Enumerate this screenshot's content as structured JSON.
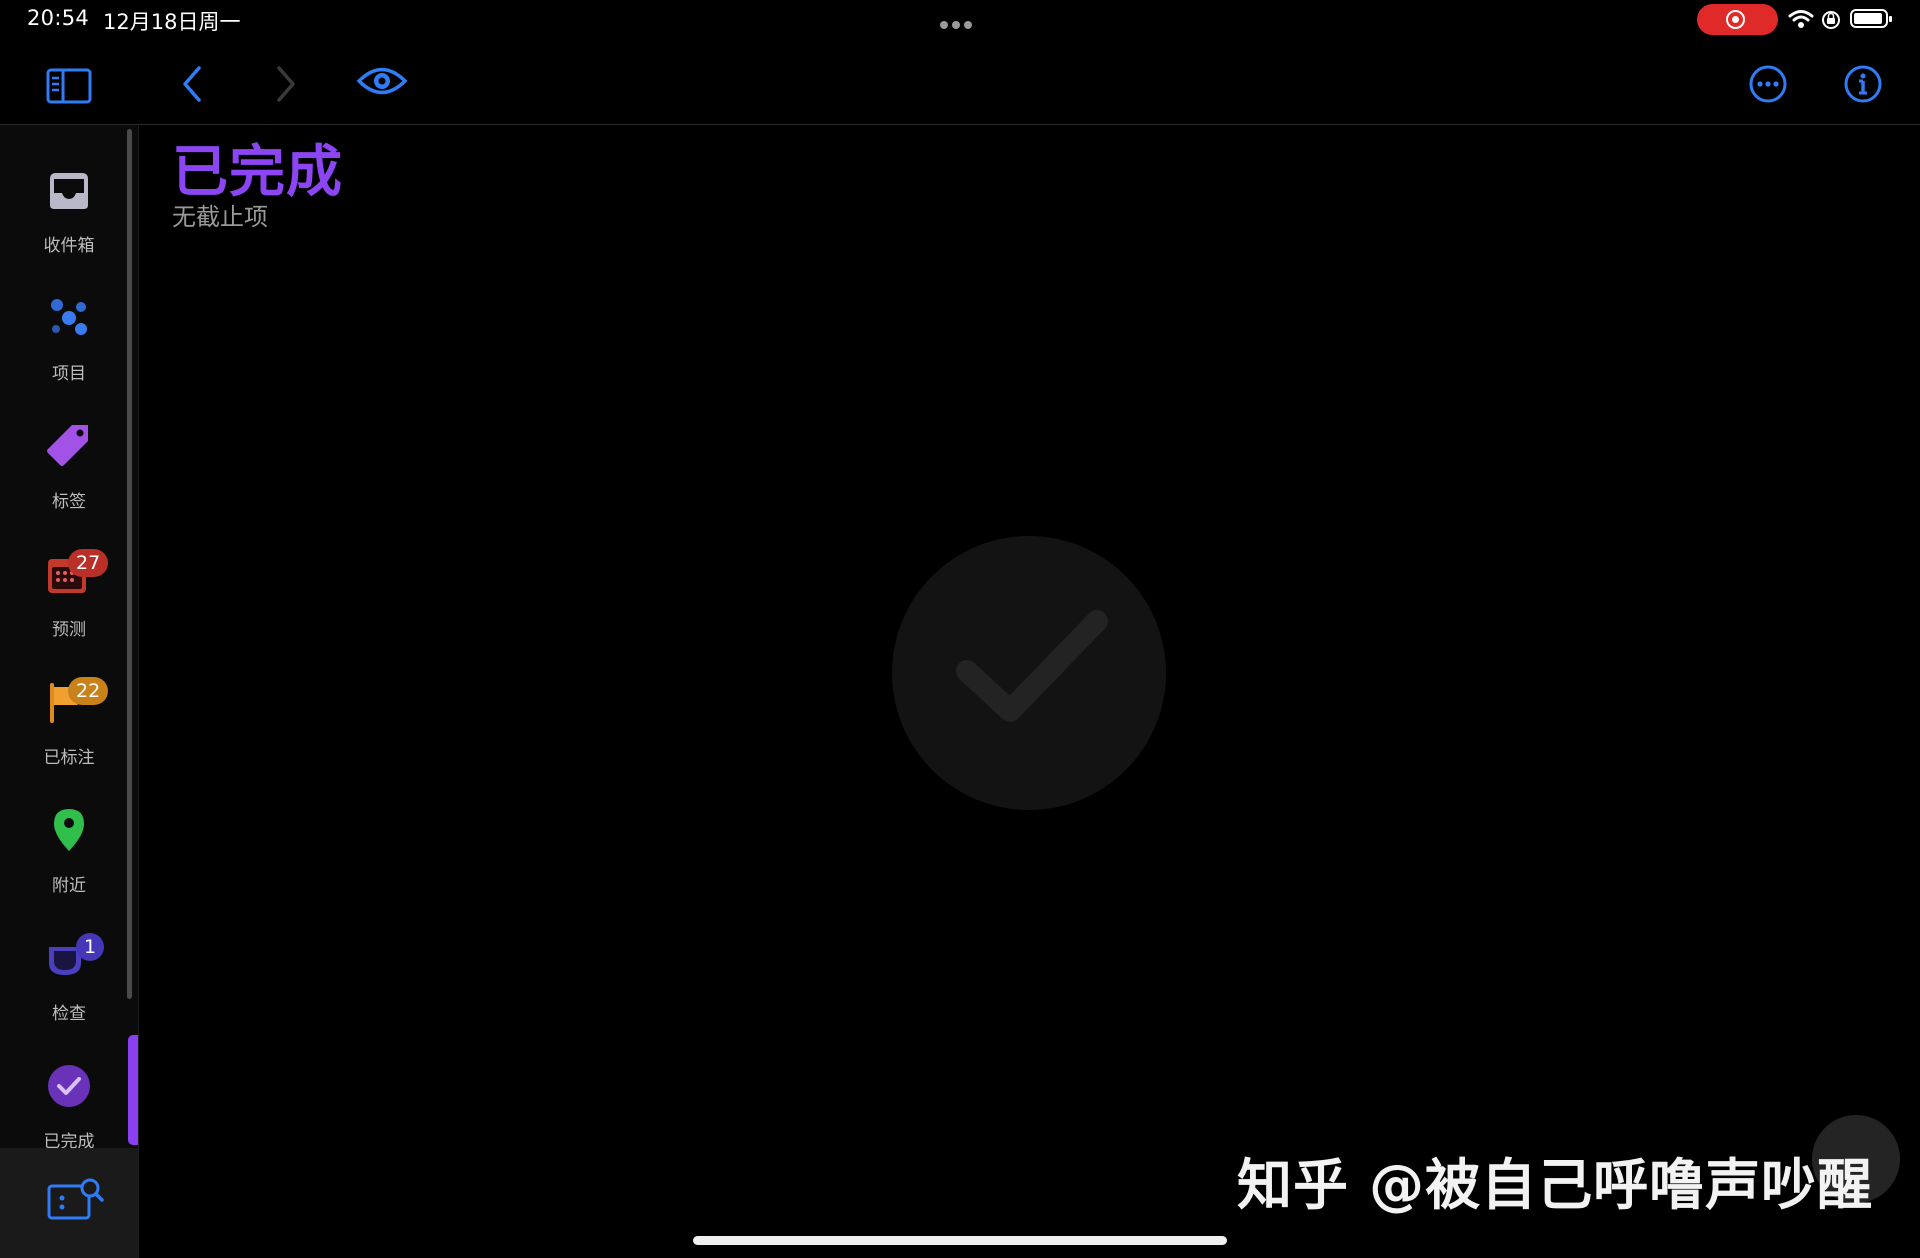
{
  "status_bar": {
    "time": "20:54",
    "date": "12月18日周一"
  },
  "toolbar": {
    "sidebar_toggle_icon": "sidebar-icon",
    "back_icon": "chevron-left-icon",
    "forward_icon": "chevron-right-icon",
    "perspective_icon": "eye-icon",
    "more_icon": "ellipsis-circle-icon",
    "info_icon": "info-circle-icon",
    "accent_color": "#2f7cf6"
  },
  "sidebar": {
    "items": [
      {
        "label": "收件箱",
        "icon": "inbox-icon"
      },
      {
        "label": "项目",
        "icon": "projects-icon"
      },
      {
        "label": "标签",
        "icon": "tag-icon"
      },
      {
        "label": "预测",
        "icon": "calendar-icon",
        "badge": "27",
        "badge_color": "#c0392b"
      },
      {
        "label": "已标注",
        "icon": "flag-icon",
        "badge": "22",
        "badge_color": "#d68910"
      },
      {
        "label": "附近",
        "icon": "map-pin-icon"
      },
      {
        "label": "检查",
        "icon": "review-cup-icon",
        "badge": "1",
        "badge_color": "#4a3fbf"
      },
      {
        "label": "已完成",
        "icon": "completed-check-icon",
        "active": true
      }
    ],
    "bottom_icon": "search-perspective-icon"
  },
  "main": {
    "title": "已完成",
    "subtitle": "无截止项",
    "title_color": "#8b45f2",
    "empty_state_icon": "checkmark-circle-icon"
  },
  "watermark": "知乎 @被自己呼噜声吵醒"
}
